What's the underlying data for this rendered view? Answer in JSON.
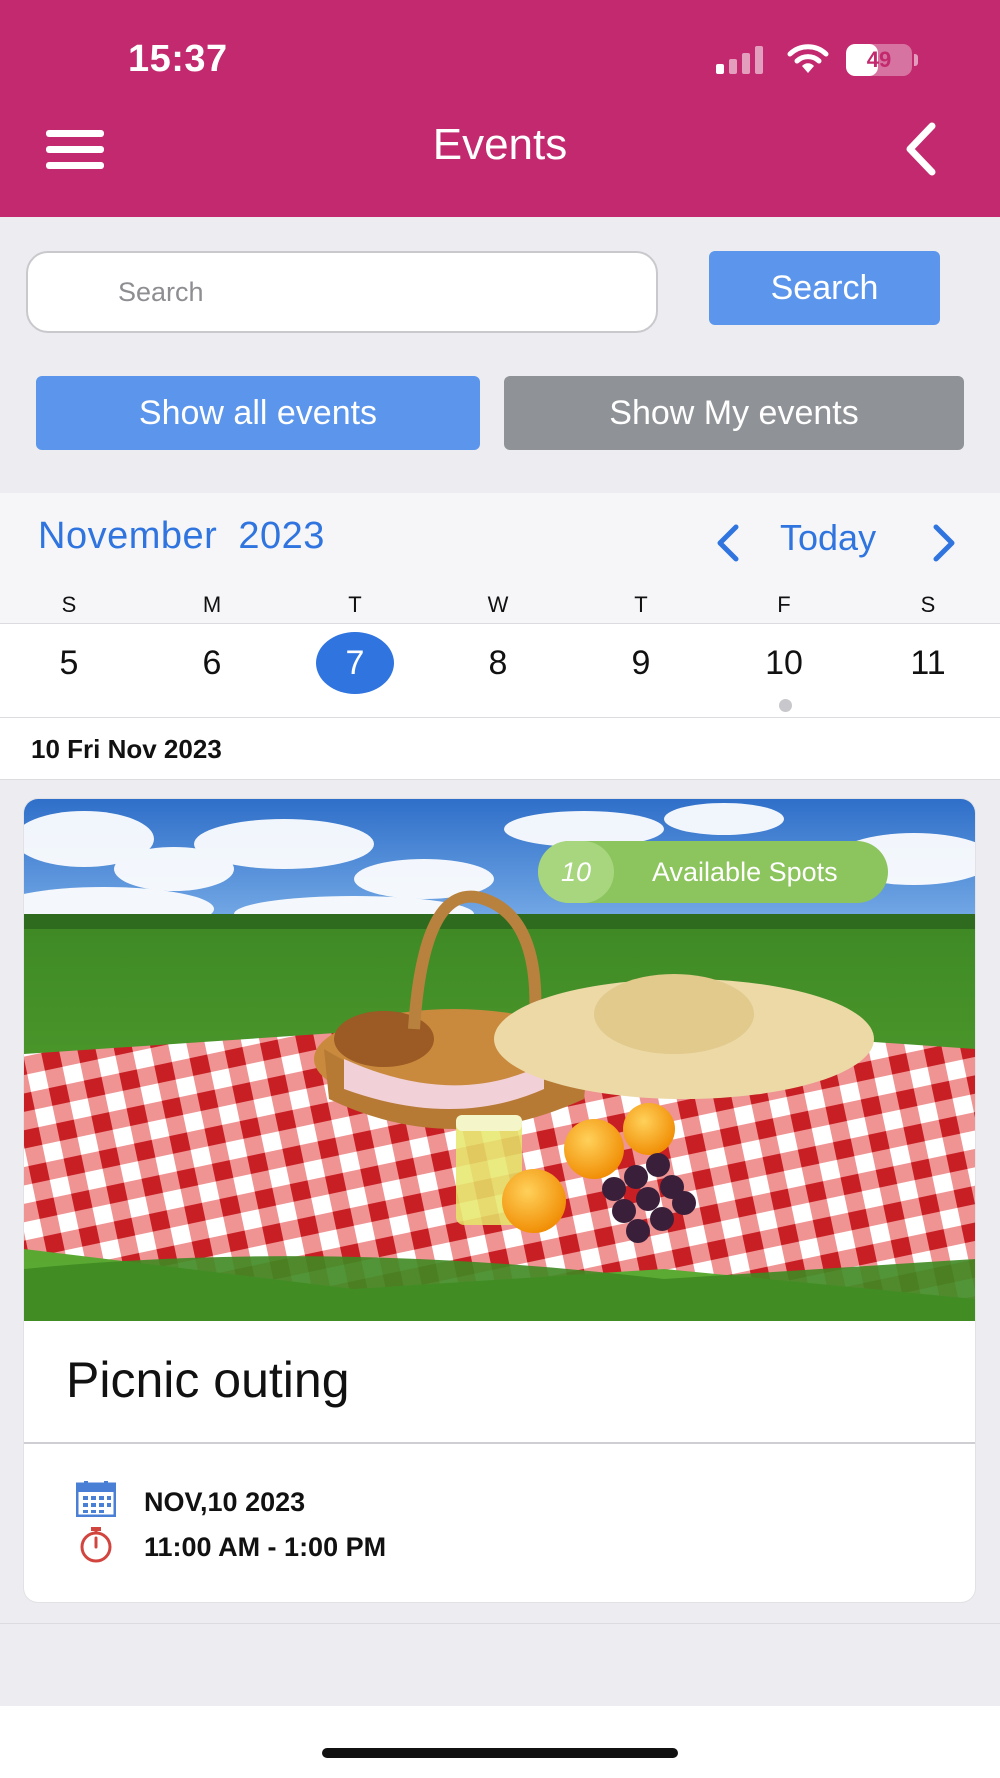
{
  "status_bar": {
    "time": "15:37",
    "battery": "49",
    "battery_level": 0.49,
    "signal_bars_active": 1
  },
  "header": {
    "title": "Events",
    "menu_icon": "hamburger-menu-icon",
    "back_icon": "chevron-left-icon",
    "background": "#c2296e"
  },
  "search": {
    "placeholder": "Search",
    "value": "",
    "button_label": "Search"
  },
  "filters": {
    "all_label": "Show all events",
    "my_label": "Show My events",
    "active_color": "#5b96ec",
    "inactive_color": "#8f9296"
  },
  "calendar": {
    "month": "November",
    "year": "2023",
    "today_label": "Today",
    "weekdays": [
      "S",
      "M",
      "T",
      "W",
      "T",
      "F",
      "S"
    ],
    "days": [
      "5",
      "6",
      "7",
      "8",
      "9",
      "10",
      "11"
    ],
    "selected_day": "7",
    "days_with_events": [
      "10"
    ],
    "accent": "#2f74df"
  },
  "date_header": "10 Fri Nov 2023",
  "event": {
    "title": "Picnic outing",
    "available_spots": "10",
    "available_label": "Available Spots",
    "date": "NOV,10 2023",
    "time": "11:00 AM - 1:00 PM",
    "image": "picnic-scene: red gingham blanket, wicker basket, straw hat, juice glass, oranges, grapes on grass under blue sky"
  }
}
